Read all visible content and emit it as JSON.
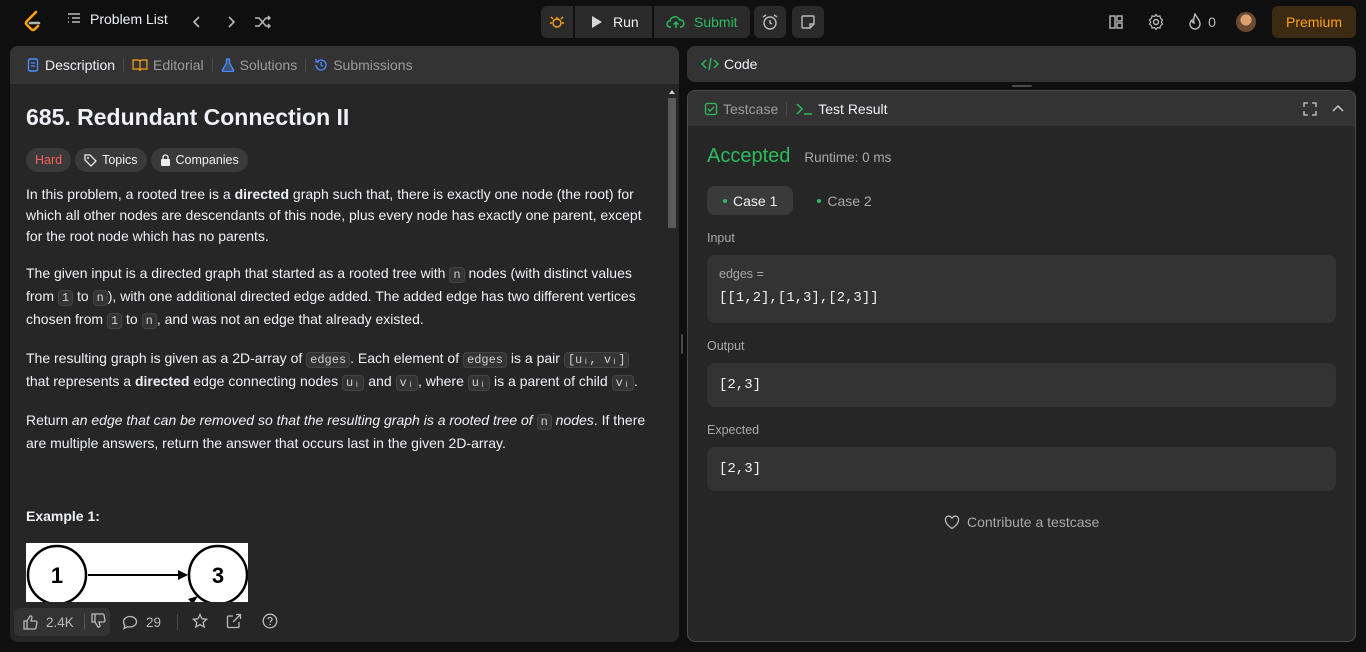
{
  "topbar": {
    "problem_list_label": "Problem List",
    "run_label": "Run",
    "submit_label": "Submit",
    "streak_count": "0",
    "premium_label": "Premium"
  },
  "left_tabs": [
    "Description",
    "Editorial",
    "Solutions",
    "Submissions"
  ],
  "problem": {
    "title": "685. Redundant Connection II",
    "difficulty": "Hard",
    "topics_label": "Topics",
    "companies_label": "Companies",
    "p1_a": "In this problem, a rooted tree is a ",
    "p1_b": "directed",
    "p1_c": " graph such that, there is exactly one node (the root) for which all other nodes are descendants of this node, plus every node has exactly one parent, except for the root node which has no parents.",
    "p2_a": "The given input is a directed graph that started as a rooted tree with ",
    "p2_n": "n",
    "p2_b": " nodes (with distinct values from ",
    "p2_1": "1",
    "p2_c": " to ",
    "p2_n2": "n",
    "p2_d": "), with one additional directed edge added. The added edge has two different vertices chosen from ",
    "p2_1b": "1",
    "p2_e": " to ",
    "p2_n3": "n",
    "p2_f": ", and was not an edge that already existed.",
    "p3_a": "The resulting graph is given as a 2D-array of ",
    "p3_edges": "edges",
    "p3_b": ". Each element of ",
    "p3_edges2": "edges",
    "p3_c": " is a pair ",
    "p3_pair": "[uᵢ, vᵢ]",
    "p3_d": " that represents a ",
    "p3_e": "directed",
    "p3_f": " edge connecting nodes ",
    "p3_u": "uᵢ",
    "p3_g": " and ",
    "p3_v": "vᵢ",
    "p3_h": ", where ",
    "p3_u2": "uᵢ",
    "p3_i": " is a parent of child ",
    "p3_v2": "vᵢ",
    "p3_j": ".",
    "p4_a": "Return ",
    "p4_b": "an edge that can be removed so that the resulting graph is a rooted tree of ",
    "p4_n": "n",
    "p4_c": " nodes",
    "p4_d": ". If there are multiple answers, return the answer that occurs last in the given 2D-array.",
    "example_title": "Example 1:",
    "graph_nodes": [
      "1",
      "3"
    ]
  },
  "bottom": {
    "likes": "2.4K",
    "comments": "29"
  },
  "right": {
    "code_label": "Code",
    "testcase_tab": "Testcase",
    "result_tab": "Test Result",
    "status": "Accepted",
    "runtime": "Runtime: 0 ms",
    "cases": [
      "Case 1",
      "Case 2"
    ],
    "input_label": "Input",
    "var_label": "edges =",
    "input_value": "[[1,2],[1,3],[2,3]]",
    "output_label": "Output",
    "output_value": "[2,3]",
    "expected_label": "Expected",
    "expected_value": "[2,3]",
    "contribute_label": "Contribute a testcase"
  },
  "colors": {
    "accent": "#ffa116",
    "accepted": "#2cbb5d",
    "hard": "#f63636",
    "link_blue": "#4a8cff"
  }
}
